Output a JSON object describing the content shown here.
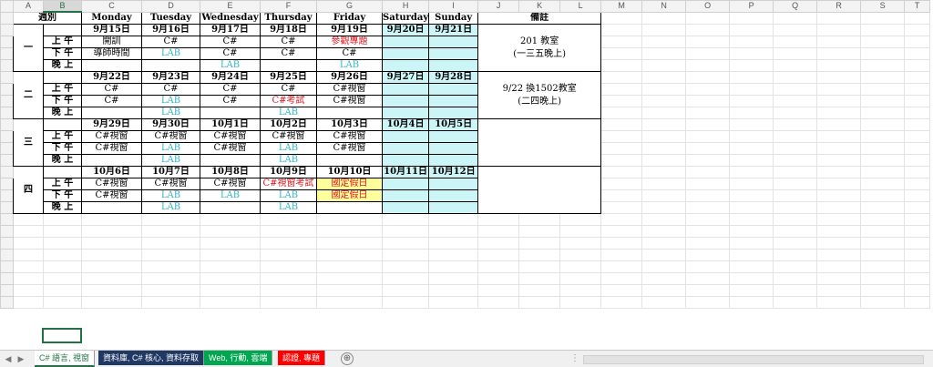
{
  "column_headers": [
    "A",
    "B",
    "C",
    "D",
    "E",
    "F",
    "G",
    "H",
    "I",
    "J",
    "K",
    "L",
    "M",
    "N",
    "O",
    "P",
    "Q",
    "R",
    "S",
    "T"
  ],
  "header_row": {
    "week_label": "週別",
    "days": [
      "Monday",
      "Tuesday",
      "Wednesday",
      "Thursday",
      "Friday",
      "Saturday",
      "Sunday"
    ],
    "notes_label": "備註"
  },
  "period_labels": [
    "上 午",
    "下 午",
    "晚 上"
  ],
  "weeks": [
    {
      "label": "一",
      "dates": [
        "9月15日",
        "9月16日",
        "9月17日",
        "9月18日",
        "9月19日",
        "9月20日",
        "9月21日"
      ],
      "morning": [
        "開訓",
        "C#",
        "C#",
        "C#",
        "參觀專題",
        "",
        ""
      ],
      "afternoon": [
        "導師時間",
        "LAB",
        "C#",
        "C#",
        "C#",
        "",
        ""
      ],
      "evening": [
        "",
        "",
        "LAB",
        "",
        "LAB",
        "",
        ""
      ],
      "note": "201 教室\n(一三五晚上)"
    },
    {
      "label": "二",
      "dates": [
        "9月22日",
        "9月23日",
        "9月24日",
        "9月25日",
        "9月26日",
        "9月27日",
        "9月28日"
      ],
      "morning": [
        "C#",
        "C#",
        "C#",
        "C#",
        "C#視窗",
        "",
        ""
      ],
      "afternoon": [
        "C#",
        "LAB",
        "C#",
        "C#考試",
        "C#視窗",
        "",
        ""
      ],
      "evening": [
        "",
        "LAB",
        "",
        "LAB",
        "",
        "",
        ""
      ],
      "note": "9/22 換1502教室\n(二四晚上)"
    },
    {
      "label": "三",
      "dates": [
        "9月29日",
        "9月30日",
        "10月1日",
        "10月2日",
        "10月3日",
        "10月4日",
        "10月5日"
      ],
      "morning": [
        "C#視窗",
        "C#視窗",
        "C#視窗",
        "C#視窗",
        "C#視窗",
        "",
        ""
      ],
      "afternoon": [
        "C#視窗",
        "LAB",
        "C#視窗",
        "LAB",
        "C#視窗",
        "",
        ""
      ],
      "evening": [
        "",
        "LAB",
        "",
        "LAB",
        "",
        "",
        ""
      ],
      "note": ""
    },
    {
      "label": "四",
      "dates": [
        "10月6日",
        "10月7日",
        "10月8日",
        "10月9日",
        "10月10日",
        "10月11日",
        "10月12日"
      ],
      "morning": [
        "C#視窗",
        "C#視窗",
        "C#視窗",
        "C#視窗考試",
        "國定假日",
        "",
        ""
      ],
      "afternoon": [
        "C#視窗",
        "LAB",
        "LAB",
        "LAB",
        "國定假日",
        "",
        ""
      ],
      "evening": [
        "",
        "LAB",
        "",
        "LAB",
        "",
        "",
        ""
      ],
      "note": ""
    }
  ],
  "sheet_tabs": [
    {
      "label": "C# 語言, 視窗",
      "style": "active"
    },
    {
      "label": "資料庫, C# 核心, 資料存取",
      "style": "navy"
    },
    {
      "label": "Web, 行動, 雲端",
      "style": "green"
    },
    {
      "label": "認證, 專題",
      "style": "red"
    }
  ],
  "nav_icons": {
    "prev": "◀",
    "next": "▶"
  },
  "add_sheet_icon": "⊕",
  "colors": {
    "accent": "#217346",
    "weekend_fill": "#ccf5f7",
    "holiday_fill": "#ffff9c",
    "lab_text": "#33b5c9",
    "alert_text": "#e4141b"
  }
}
